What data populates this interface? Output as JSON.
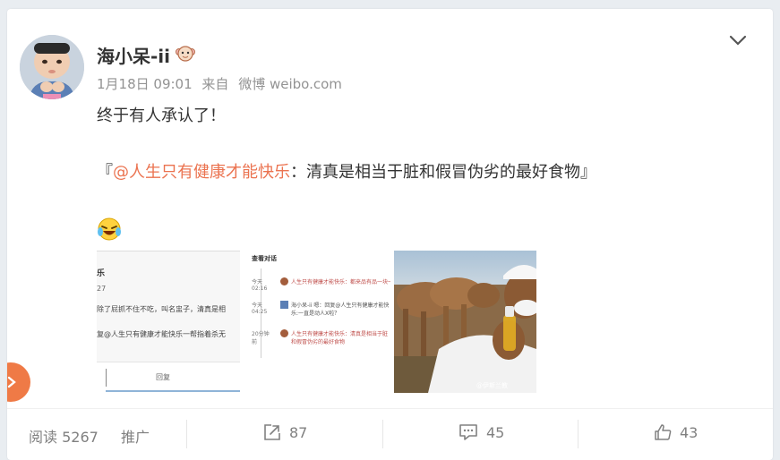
{
  "user": {
    "name": "海小呆-ii",
    "meta": {
      "date": "1月18日 09:01",
      "from": "来自",
      "source": "微博 weibo.com"
    }
  },
  "post": {
    "line1": "终于有人承认了！",
    "quote_open": "『",
    "mention": "@人生只有健康才能快乐",
    "quote_text": "：清真是相当于脏和假冒伪劣的最好食物",
    "quote_close": "』"
  },
  "thumb1": {
    "title": "乐",
    "num": "27",
    "line1": "除了屁抓不住不吃，叫名盅子，清真是相",
    "line2": "复@人生只有健康才能快乐一帮指着杀无",
    "btn": "回复"
  },
  "thumb2": {
    "title": "查看对话",
    "rows": [
      {
        "time": "今天 02:16",
        "text": "人生只有健康才能快乐：都来品有品一块一样"
      },
      {
        "time": "今天 04:25",
        "text": "海小呆-ii 嗯：回复@人生只有健康才能快乐:一直是动人X啦？"
      },
      {
        "time": "20分钟前",
        "text": "人生只有健康才能快乐：清真是相当于脏和假冒伪劣的最好食物"
      }
    ]
  },
  "thumb3": {
    "watermark": "@伊斯兰教"
  },
  "footer": {
    "read_label": "阅读",
    "read_count": "5267",
    "promote": "推广",
    "repost_count": "87",
    "comment_count": "45",
    "like_count": "43"
  },
  "colors": {
    "mention": "#eb7350",
    "side_button": "#ef7a46",
    "text": "#333333",
    "meta": "#939393"
  }
}
